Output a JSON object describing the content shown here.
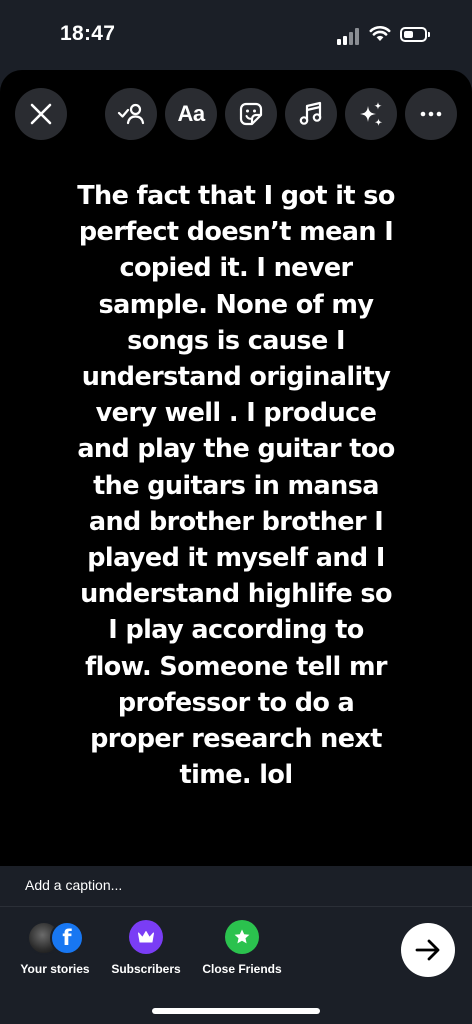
{
  "status_bar": {
    "time": "18:47"
  },
  "toolbar": {
    "close": "close-icon",
    "tag_people": "tag-people-icon",
    "text_label": "Aa",
    "sticker": "sticker-icon",
    "music": "music-note-icon",
    "effects": "sparkles-icon",
    "more": "more-icon"
  },
  "story": {
    "text": "The fact that I got it so\nperfect doesn’t mean I\ncopied it. I never\nsample. None of my\nsongs is cause I\nunderstand originality\nvery well . I produce\nand play the guitar too\nthe guitars in mansa\nand brother brother I\nplayed it myself and I\nunderstand highlife so\nI play according to\nflow. Someone tell mr\nprofessor to do a\nproper research next\ntime. lol"
  },
  "caption": {
    "placeholder": "Add a caption..."
  },
  "share_options": [
    {
      "label": "Your stories"
    },
    {
      "label": "Subscribers",
      "color": "#7a3df5"
    },
    {
      "label": "Close Friends",
      "color": "#2bc24e"
    }
  ],
  "next_button": {
    "icon": "arrow-right-icon"
  }
}
